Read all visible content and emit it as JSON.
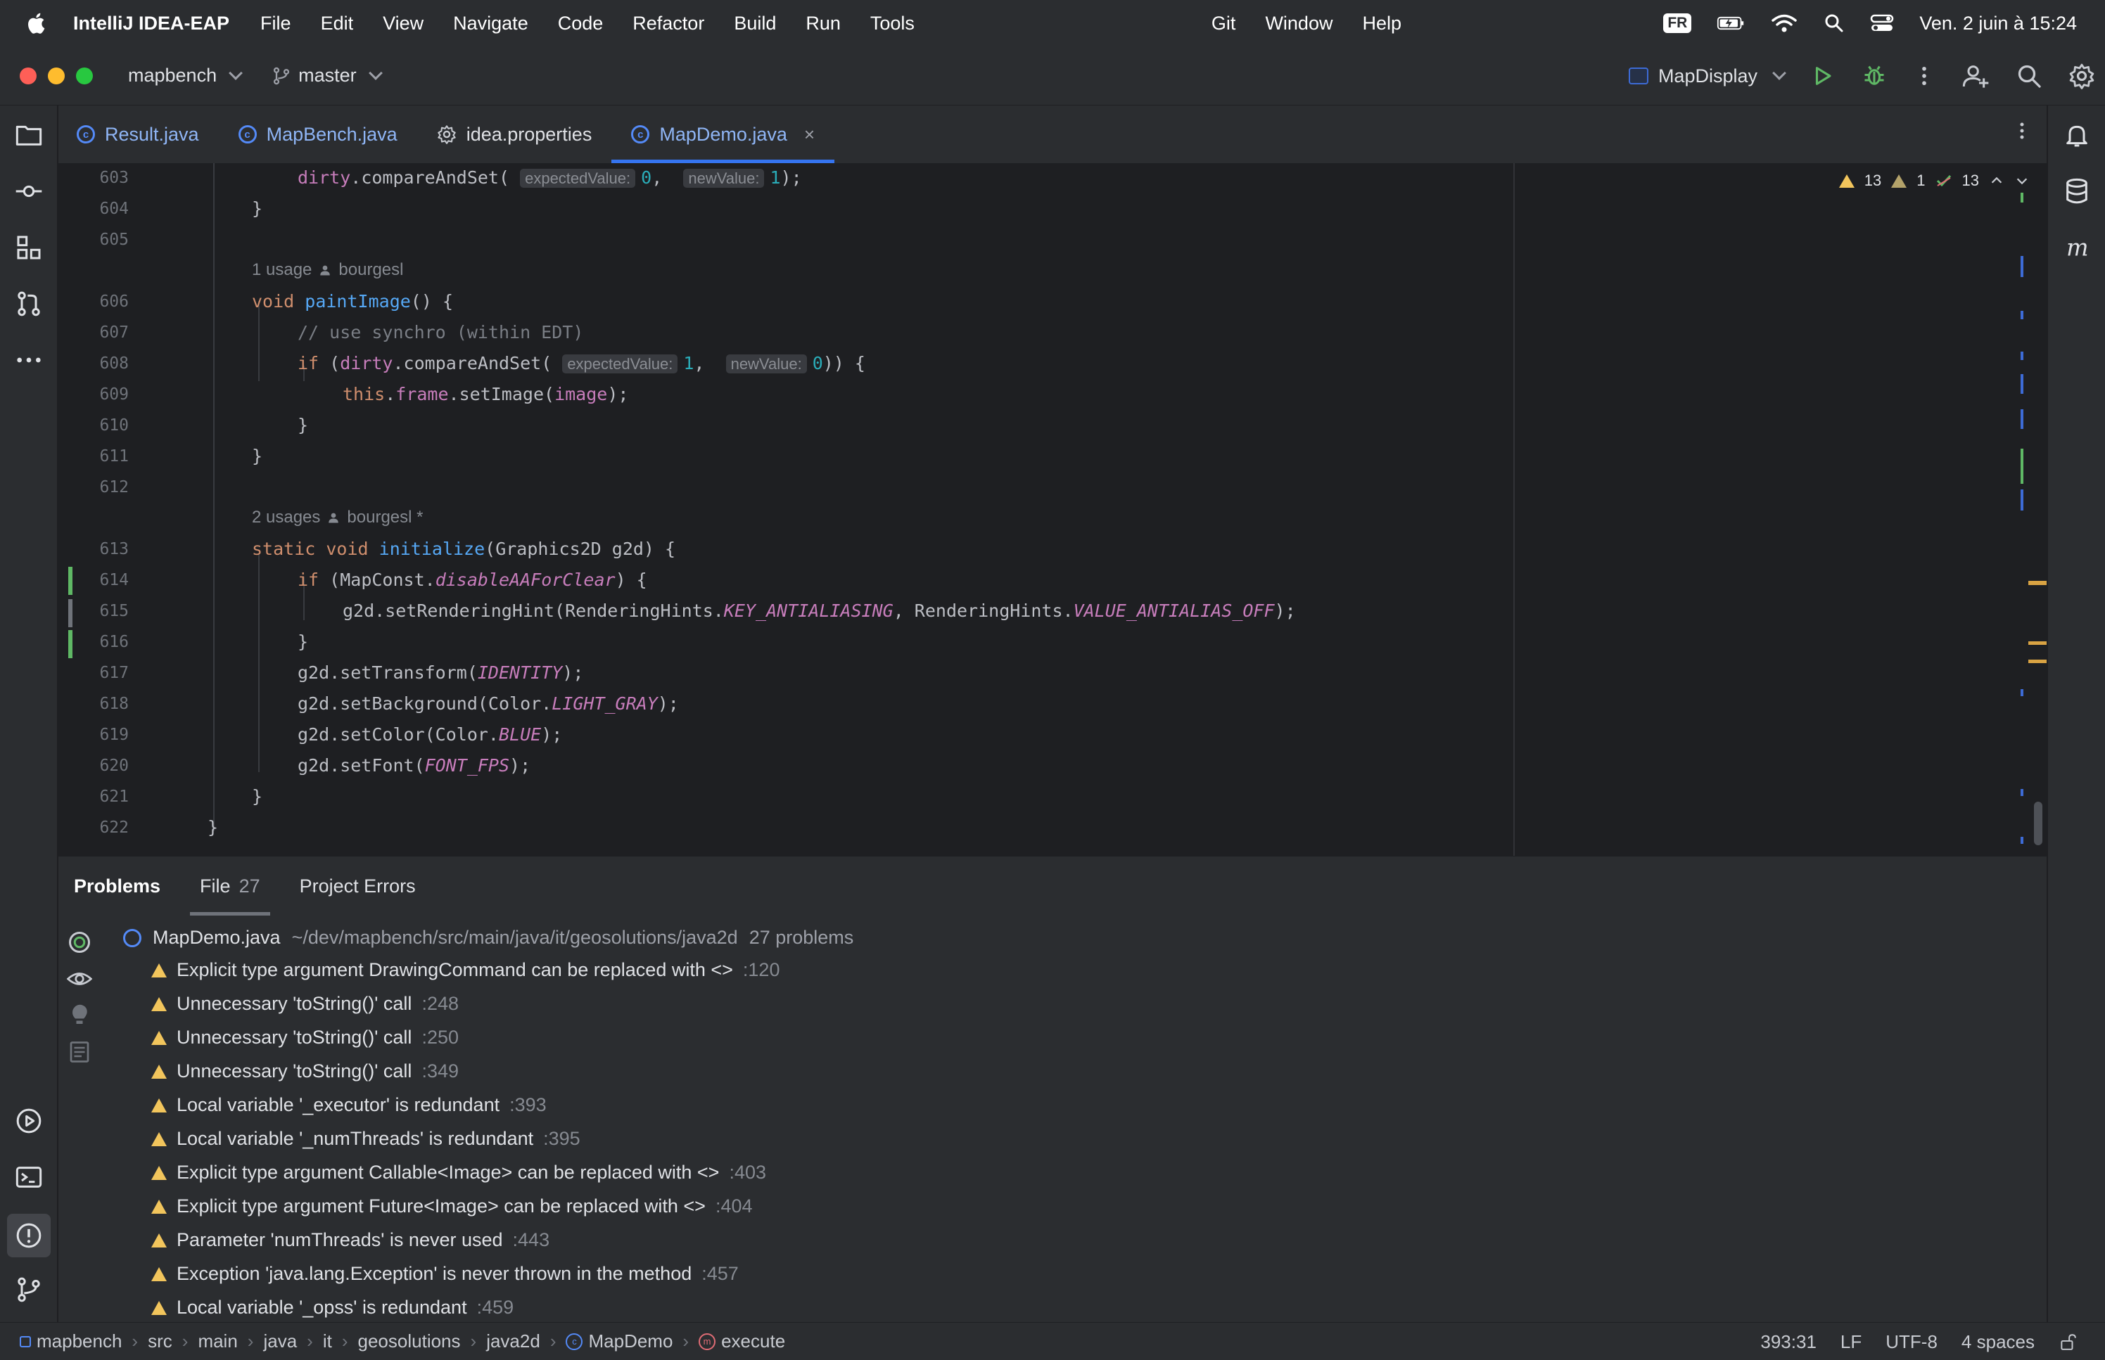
{
  "menubar": {
    "app_name": "IntelliJ IDEA-EAP",
    "items": [
      "File",
      "Edit",
      "View",
      "Navigate",
      "Code",
      "Refactor",
      "Build",
      "Run",
      "Tools"
    ],
    "items_right": [
      "Git",
      "Window",
      "Help"
    ],
    "input_source": "FR",
    "datetime": "Ven. 2 juin à 15:24"
  },
  "toolbar": {
    "project": "mapbench",
    "branch": "master",
    "run_config": "MapDisplay"
  },
  "tabs": [
    {
      "label": "Result.java"
    },
    {
      "label": "MapBench.java"
    },
    {
      "label": "idea.properties"
    },
    {
      "label": "MapDemo.java",
      "close": "×"
    }
  ],
  "editor": {
    "inspections": {
      "warnings": "13",
      "weak_warnings": "1",
      "ok": "13"
    },
    "lines": {
      "603": "603",
      "604": "604",
      "605": "605",
      "606": "606",
      "607": "607",
      "608": "608",
      "609": "609",
      "610": "610",
      "611": "611",
      "612": "612",
      "613": "613",
      "614": "614",
      "615": "615",
      "616": "616",
      "617": "617",
      "618": "618",
      "619": "619",
      "620": "620",
      "621": "621",
      "622": "622"
    },
    "hints": {
      "paint_usages": "1 usage",
      "paint_author": "bourgesl",
      "init_usages": "2 usages",
      "init_author": "bourgesl *"
    },
    "inlay": {
      "expected": "expectedValue:",
      "new": "newValue:"
    }
  },
  "problems": {
    "tabs": [
      {
        "label": "Problems"
      },
      {
        "label": "File",
        "count": "27"
      },
      {
        "label": "Project Errors"
      }
    ],
    "file": {
      "name": "MapDemo.java",
      "path": "~/dev/mapbench/src/main/java/it/geosolutions/java2d",
      "count": "27 problems"
    },
    "items": [
      {
        "text": "Explicit type argument DrawingCommand can be replaced with <>",
        "line": ":120"
      },
      {
        "text": "Unnecessary 'toString()' call",
        "line": ":248"
      },
      {
        "text": "Unnecessary 'toString()' call",
        "line": ":250"
      },
      {
        "text": "Unnecessary 'toString()' call",
        "line": ":349"
      },
      {
        "text": "Local variable '_executor' is redundant",
        "line": ":393"
      },
      {
        "text": "Local variable '_numThreads' is redundant",
        "line": ":395"
      },
      {
        "text": "Explicit type argument Callable<Image> can be replaced with <>",
        "line": ":403"
      },
      {
        "text": "Explicit type argument Future<Image> can be replaced with <>",
        "line": ":404"
      },
      {
        "text": "Parameter 'numThreads' is never used",
        "line": ":443"
      },
      {
        "text": "Exception 'java.lang.Exception' is never thrown in the method",
        "line": ":457"
      },
      {
        "text": "Local variable '_opss' is redundant",
        "line": ":459"
      }
    ]
  },
  "statusbar": {
    "breadcrumbs": [
      "mapbench",
      "src",
      "main",
      "java",
      "it",
      "geosolutions",
      "java2d",
      "MapDemo",
      "execute"
    ],
    "position": "393:31",
    "line_sep": "LF",
    "encoding": "UTF-8",
    "indent": "4 spaces"
  },
  "colors": {
    "accent": "#3574f0",
    "warning": "#f2c55c",
    "keyword": "#cf8e6d",
    "function": "#56a8f5",
    "field": "#c77dbb",
    "number": "#2aacb8"
  }
}
